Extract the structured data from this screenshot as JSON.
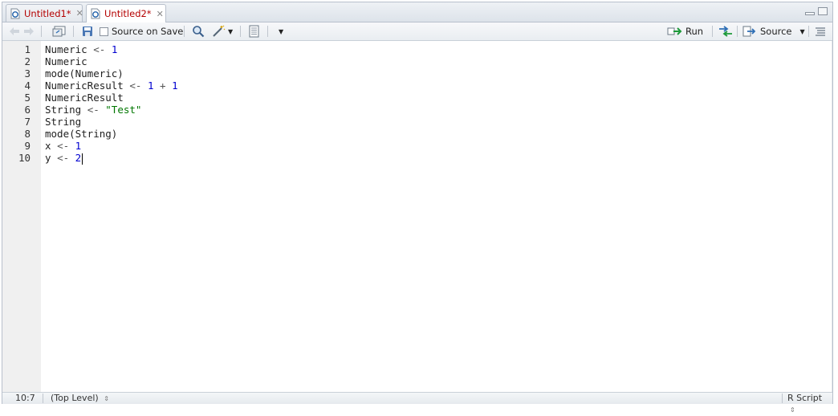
{
  "tabs": [
    {
      "label": "Untitled1*",
      "active": false
    },
    {
      "label": "Untitled2*",
      "active": true
    }
  ],
  "toolbar": {
    "source_on_save_label": "Source on Save",
    "run_label": "Run",
    "source_label": "Source"
  },
  "editor": {
    "lines": [
      {
        "num": "1",
        "tokens": [
          {
            "t": "Numeric ",
            "c": "id"
          },
          {
            "t": "<-",
            "c": "op"
          },
          {
            "t": " ",
            "c": "id"
          },
          {
            "t": "1",
            "c": "num"
          }
        ]
      },
      {
        "num": "2",
        "tokens": [
          {
            "t": "Numeric",
            "c": "id"
          }
        ]
      },
      {
        "num": "3",
        "tokens": [
          {
            "t": "mode(Numeric)",
            "c": "id"
          }
        ]
      },
      {
        "num": "4",
        "tokens": [
          {
            "t": "NumericResult ",
            "c": "id"
          },
          {
            "t": "<-",
            "c": "op"
          },
          {
            "t": " ",
            "c": "id"
          },
          {
            "t": "1",
            "c": "num"
          },
          {
            "t": " + ",
            "c": "op"
          },
          {
            "t": "1",
            "c": "num"
          }
        ]
      },
      {
        "num": "5",
        "tokens": [
          {
            "t": "NumericResult",
            "c": "id"
          }
        ]
      },
      {
        "num": "6",
        "tokens": [
          {
            "t": "String ",
            "c": "id"
          },
          {
            "t": "<-",
            "c": "op"
          },
          {
            "t": " ",
            "c": "id"
          },
          {
            "t": "\"Test\"",
            "c": "str"
          }
        ]
      },
      {
        "num": "7",
        "tokens": [
          {
            "t": "String",
            "c": "id"
          }
        ]
      },
      {
        "num": "8",
        "tokens": [
          {
            "t": "mode(String)",
            "c": "id"
          }
        ]
      },
      {
        "num": "9",
        "tokens": [
          {
            "t": "x ",
            "c": "id"
          },
          {
            "t": "<-",
            "c": "op"
          },
          {
            "t": " ",
            "c": "id"
          },
          {
            "t": "1",
            "c": "num"
          }
        ]
      },
      {
        "num": "10",
        "tokens": [
          {
            "t": "y ",
            "c": "id"
          },
          {
            "t": "<-",
            "c": "op"
          },
          {
            "t": " ",
            "c": "id"
          },
          {
            "t": "2",
            "c": "num"
          }
        ]
      }
    ],
    "cursor_line": 10
  },
  "status": {
    "position": "10:7",
    "scope": "(Top Level)",
    "file_type": "R Script"
  },
  "colors": {
    "tab_text": "#b40000",
    "number": "#0000d0",
    "string": "#007700",
    "gutter_bg": "#f0f0f0"
  }
}
